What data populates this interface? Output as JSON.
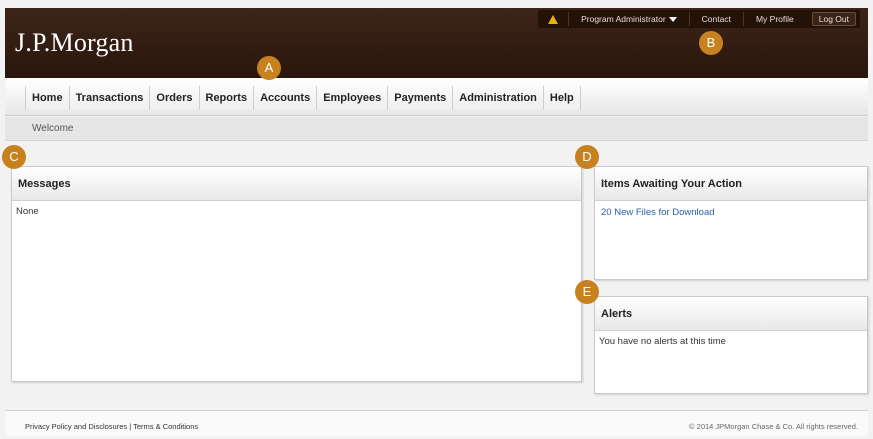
{
  "header": {
    "logo_text": "J.P.Morgan",
    "utility": {
      "role_label": "Program Administrator",
      "contact_label": "Contact",
      "profile_label": "My Profile",
      "logout_label": "Log Out"
    }
  },
  "nav": {
    "tabs": [
      {
        "label": "Home"
      },
      {
        "label": "Transactions"
      },
      {
        "label": "Orders"
      },
      {
        "label": "Reports"
      },
      {
        "label": "Accounts"
      },
      {
        "label": "Employees"
      },
      {
        "label": "Payments"
      },
      {
        "label": "Administration"
      },
      {
        "label": "Help"
      }
    ]
  },
  "subnav": {
    "label": "Welcome"
  },
  "markers": {
    "a": "A",
    "b": "B",
    "c": "C",
    "d": "D",
    "e": "E"
  },
  "messages": {
    "title": "Messages",
    "body": "None"
  },
  "awaiting": {
    "title": "Items Awaiting Your Action",
    "link": "20 New Files for Download"
  },
  "alerts": {
    "title": "Alerts",
    "body": "You have no alerts at this time"
  },
  "footer": {
    "privacy": "Privacy Policy and Disclosures |",
    "terms": "Terms & Conditions",
    "copyright": "© 2014 JPMorgan Chase & Co. All rights reserved."
  },
  "colors": {
    "header_bg": "#2e190f",
    "marker": "#c7821f",
    "link": "#2a5fa6",
    "warning": "#e8b20a"
  }
}
